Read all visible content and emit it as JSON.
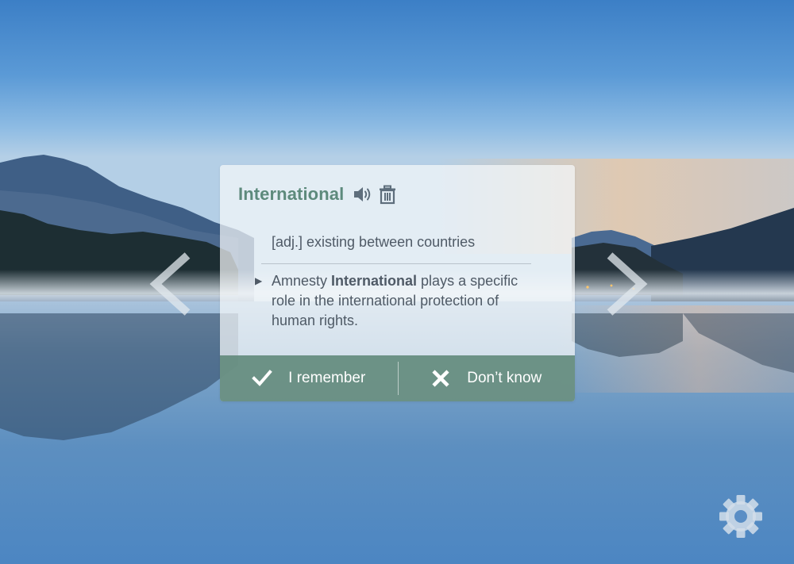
{
  "card": {
    "word": "International",
    "definition": "[adj.] existing between countries",
    "example": {
      "before": "Amnesty ",
      "highlight": "International",
      "after": " plays a specific role in the international protection of human rights."
    }
  },
  "actions": {
    "remember_label": "I remember",
    "dont_know_label": "Don’t know"
  },
  "icons": {
    "sound": "speaker-icon",
    "delete": "trash-icon",
    "prev": "chevron-left-icon",
    "next": "chevron-right-icon",
    "remember": "check-icon",
    "dont_know": "x-icon",
    "settings": "gear-icon"
  },
  "colors": {
    "accent": "#5d8a7c",
    "action_bar": "#5d8678",
    "text": "#4f5a66"
  }
}
